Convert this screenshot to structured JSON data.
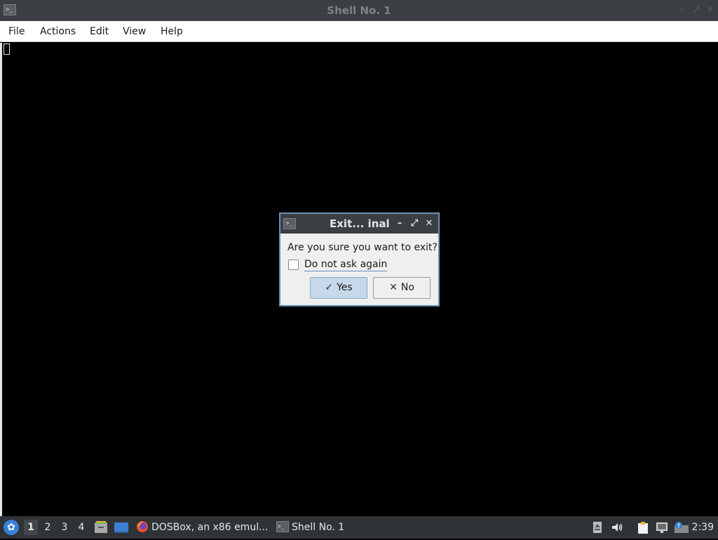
{
  "window": {
    "title": "Shell No. 1",
    "icon": "terminal-icon",
    "controls": [
      "minimize-icon",
      "maximize-icon",
      "close-icon"
    ]
  },
  "menu": {
    "items": [
      {
        "label": "File"
      },
      {
        "label": "Actions"
      },
      {
        "label": "Edit"
      },
      {
        "label": "View"
      },
      {
        "label": "Help"
      }
    ]
  },
  "dialog": {
    "title": "Exit... inal",
    "icon": "terminal-icon",
    "question": "Are you sure you want to exit?",
    "checkbox_label": "Do not ask again",
    "checkbox_checked": false,
    "yes_label": "Yes",
    "no_label": "No",
    "accent": "#6f8fb8"
  },
  "taskbar": {
    "desktops": [
      {
        "label": "1",
        "active": true
      },
      {
        "label": "2",
        "active": false
      },
      {
        "label": "3",
        "active": false
      },
      {
        "label": "4",
        "active": false
      }
    ],
    "launchers": [
      "file-manager-icon",
      "show-desktop-icon"
    ],
    "tasks": [
      {
        "label": "DOSBox, an x86 emul...",
        "icon": "firefox-icon"
      },
      {
        "label": "Shell No. 1",
        "icon": "terminal-icon"
      }
    ],
    "tray": [
      "eject-icon",
      "volume-icon",
      "clipboard-icon",
      "network-icon",
      "update-notifier-icon",
      "display-icon"
    ],
    "clock": "2:39"
  },
  "colors": {
    "titlebar": "#3b3f43",
    "taskbar": "#2f3336",
    "terminal_bg": "#000000",
    "button_default": "#c6d8ea"
  }
}
